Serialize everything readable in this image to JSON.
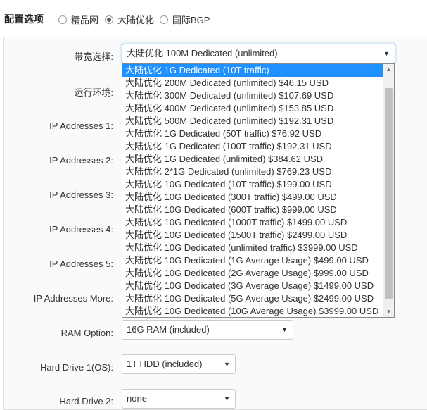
{
  "header": {
    "title": "配置选项",
    "radios": [
      {
        "label": "精品网",
        "checked": false
      },
      {
        "label": "大陆优化",
        "checked": true
      },
      {
        "label": "国际BGP",
        "checked": false
      }
    ]
  },
  "form": {
    "bandwidth_label": "带宽选择:",
    "bandwidth_value": "大陆优化 100M Dedicated (unlimited)",
    "runtime_label": "运行环境:",
    "ip1_label": "IP Addresses 1:",
    "ip2_label": "IP Addresses 2:",
    "ip3_label": "IP Addresses 3:",
    "ip4_label": "IP Addresses 4:",
    "ip5_label": "IP Addresses 5:",
    "ip_more_label": "IP Addresses More:",
    "ram_label": "RAM Option:",
    "ram_value": "16G RAM (included)",
    "hd1_label": "Hard Drive 1(OS):",
    "hd1_value": "1T HDD (included)",
    "hd2_label": "Hard Drive 2:",
    "hd2_value": "none"
  },
  "dropdown": {
    "options": [
      "大陆优化 1G Dedicated (10T traffic)",
      "大陆优化 200M Dedicated (unlimited) $46.15 USD",
      "大陆优化 300M Dedicated (unlimited) $107.69 USD",
      "大陆优化 400M Dedicated (unlimited) $153.85 USD",
      "大陆优化 500M Dedicated (unlimited) $192.31 USD",
      "大陆优化 1G Dedicated (50T traffic) $76.92 USD",
      "大陆优化 1G Dedicated (100T traffic) $192.31 USD",
      "大陆优化 1G Dedicated (unlimited) $384.62 USD",
      "大陆优化 2*1G Dedicated (unlimited) $769.23 USD",
      "大陆优化 10G Dedicated (10T traffic) $199.00 USD",
      "大陆优化 10G Dedicated (300T traffic) $499.00 USD",
      "大陆优化 10G Dedicated (600T traffic) $999.00 USD",
      "大陆优化 10G Dedicated (1000T traffic) $1499.00 USD",
      "大陆优化 10G Dedicated (1500T traffic) $2499.00 USD",
      "大陆优化 10G Dedicated (unlimited traffic) $3999.00 USD",
      "大陆优化 10G Dedicated (1G Average Usage) $499.00 USD",
      "大陆优化 10G Dedicated (2G Average Usage) $999.00 USD",
      "大陆优化 10G Dedicated (3G Average Usage) $1499.00 USD",
      "大陆优化 10G Dedicated (5G Average Usage) $2499.00 USD",
      "大陆优化 10G Dedicated (10G Average Usage) $3999.00 USD"
    ]
  },
  "icons": {
    "select_arrow": "chevron-down-icon",
    "scroll_up": "scroll-up-arrow-icon",
    "scroll_down": "scroll-down-arrow-icon"
  },
  "colors": {
    "highlight": "#1e90ff",
    "focus_border": "#66afe9"
  }
}
